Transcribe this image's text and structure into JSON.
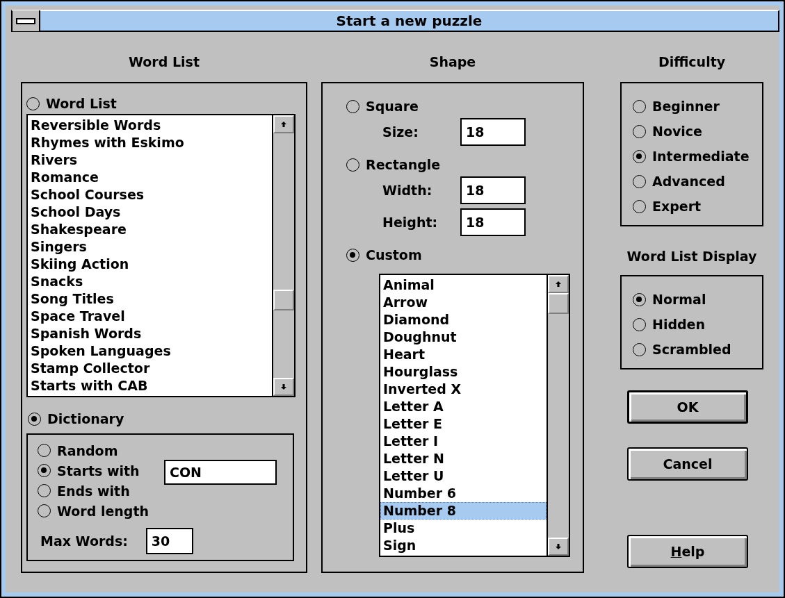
{
  "window": {
    "title": "Start a new puzzle"
  },
  "word_list": {
    "heading": "Word List",
    "source_options": [
      {
        "label": "Word List",
        "selected": false
      },
      {
        "label": "Dictionary",
        "selected": true
      }
    ],
    "list_items": [
      {
        "label": "Reversible Words",
        "selected": false
      },
      {
        "label": "Rhymes with Eskimo",
        "selected": false
      },
      {
        "label": "Rivers",
        "selected": false
      },
      {
        "label": "Romance",
        "selected": false
      },
      {
        "label": "School Courses",
        "selected": false
      },
      {
        "label": "School Days",
        "selected": false
      },
      {
        "label": "Shakespeare",
        "selected": false
      },
      {
        "label": "Singers",
        "selected": false
      },
      {
        "label": "Skiing Action",
        "selected": false
      },
      {
        "label": "Snacks",
        "selected": false
      },
      {
        "label": "Song Titles",
        "selected": false
      },
      {
        "label": "Space Travel",
        "selected": false
      },
      {
        "label": "Spanish Words",
        "selected": false
      },
      {
        "label": "Spoken Languages",
        "selected": false
      },
      {
        "label": "Stamp Collector",
        "selected": false
      },
      {
        "label": "Starts with CAB",
        "selected": false
      }
    ],
    "dictionary_options": [
      {
        "label": "Random",
        "selected": false
      },
      {
        "label": "Starts with",
        "selected": true,
        "value": "CON"
      },
      {
        "label": "Ends with",
        "selected": false
      },
      {
        "label": "Word length",
        "selected": false
      }
    ],
    "max_words": {
      "label": "Max Words:",
      "value": "30"
    }
  },
  "shape": {
    "heading": "Shape",
    "options": [
      {
        "label": "Square",
        "selected": false,
        "fields": [
          {
            "label": "Size:",
            "value": "18"
          }
        ]
      },
      {
        "label": "Rectangle",
        "selected": false,
        "fields": [
          {
            "label": "Width:",
            "value": "18"
          },
          {
            "label": "Height:",
            "value": "18"
          }
        ]
      },
      {
        "label": "Custom",
        "selected": true
      }
    ],
    "custom_list": [
      {
        "label": "Animal",
        "selected": false
      },
      {
        "label": "Arrow",
        "selected": false
      },
      {
        "label": "Diamond",
        "selected": false
      },
      {
        "label": "Doughnut",
        "selected": false
      },
      {
        "label": "Heart",
        "selected": false
      },
      {
        "label": "Hourglass",
        "selected": false
      },
      {
        "label": "Inverted X",
        "selected": false
      },
      {
        "label": "Letter A",
        "selected": false
      },
      {
        "label": "Letter E",
        "selected": false
      },
      {
        "label": "Letter I",
        "selected": false
      },
      {
        "label": "Letter N",
        "selected": false
      },
      {
        "label": "Letter U",
        "selected": false
      },
      {
        "label": "Number 6",
        "selected": false
      },
      {
        "label": "Number 8",
        "selected": true
      },
      {
        "label": "Plus",
        "selected": false
      },
      {
        "label": "Sign",
        "selected": false
      }
    ]
  },
  "difficulty": {
    "heading": "Difficulty",
    "options": [
      {
        "label": "Beginner",
        "selected": false
      },
      {
        "label": "Novice",
        "selected": false
      },
      {
        "label": "Intermediate",
        "selected": true
      },
      {
        "label": "Advanced",
        "selected": false
      },
      {
        "label": "Expert",
        "selected": false
      }
    ]
  },
  "word_list_display": {
    "heading": "Word List Display",
    "options": [
      {
        "label": "Normal",
        "selected": true
      },
      {
        "label": "Hidden",
        "selected": false
      },
      {
        "label": "Scrambled",
        "selected": false
      }
    ]
  },
  "buttons": [
    {
      "label": "OK",
      "default": true
    },
    {
      "label": "Cancel",
      "default": false
    },
    {
      "label_parts": [
        {
          "text": "H",
          "underlined": true
        },
        {
          "text": "elp",
          "underlined": false
        }
      ],
      "default": false
    }
  ]
}
